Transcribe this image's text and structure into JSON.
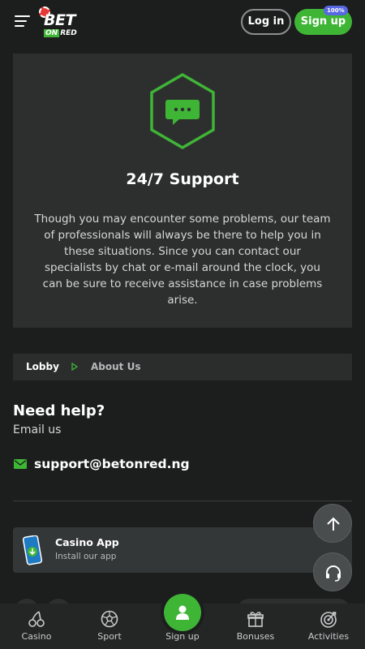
{
  "header": {
    "logo": {
      "top": "BET",
      "on": "ON",
      "red": "RED"
    },
    "login_label": "Log in",
    "signup_label": "Sign up",
    "signup_badge": "100%"
  },
  "support": {
    "icon": "chat-bubble-icon",
    "title": "24/7 Support",
    "text": "Though you may encounter some problems, our team of professionals will always be there to help you in these situations. Since you can contact our specialists by chat or e-mail around the clock, you can be sure to receive assistance in case problems arise."
  },
  "breadcrumb": {
    "items": [
      "Lobby",
      "About Us"
    ]
  },
  "help": {
    "title": "Need help?",
    "subtitle": "Email us",
    "email": "support@betonred.ng"
  },
  "app": {
    "title": "Casino App",
    "subtitle": "Install our app"
  },
  "bottom_nav": {
    "items": [
      {
        "label": "Casino",
        "icon": "cherries-icon"
      },
      {
        "label": "Sport",
        "icon": "soccer-ball-icon"
      },
      {
        "label": "Sign up",
        "icon": "user-icon"
      },
      {
        "label": "Bonuses",
        "icon": "gift-icon"
      },
      {
        "label": "Activities",
        "icon": "target-icon"
      }
    ]
  },
  "colors": {
    "accent": "#3fb536",
    "background": "#1c1e1e",
    "card": "#2d2f2f",
    "badge": "#5867e2"
  }
}
